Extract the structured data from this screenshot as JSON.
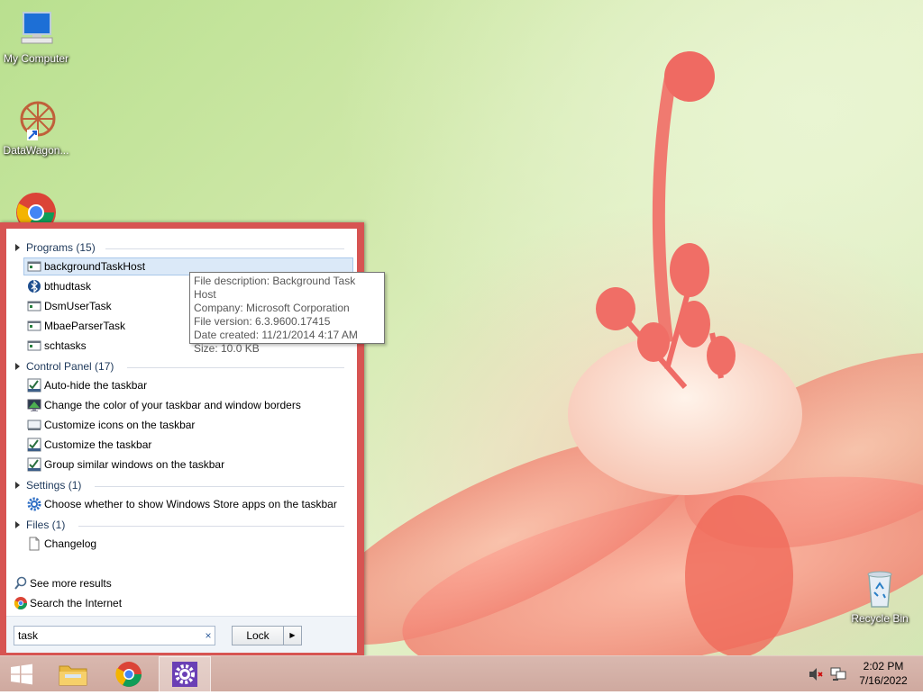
{
  "desktop": {
    "icons": [
      {
        "label": "My Computer",
        "icon": "computer-icon"
      },
      {
        "label": "DataWagon...",
        "icon": "datawagon-icon"
      },
      {
        "label": "",
        "icon": "chrome-icon"
      },
      {
        "label": "Recycle Bin",
        "icon": "recycle-bin-icon"
      }
    ]
  },
  "start_menu": {
    "groups": [
      {
        "header": "Programs (15)",
        "items": [
          {
            "label": "backgroundTaskHost",
            "icon": "app-window-icon",
            "selected": true
          },
          {
            "label": "bthudtask",
            "icon": "bluetooth-icon"
          },
          {
            "label": "DsmUserTask",
            "icon": "app-window-icon"
          },
          {
            "label": "MbaeParserTask",
            "icon": "app-window-icon"
          },
          {
            "label": "schtasks",
            "icon": "app-window-icon"
          }
        ]
      },
      {
        "header": "Control Panel (17)",
        "items": [
          {
            "label": "Auto-hide the taskbar",
            "icon": "taskbar-checklist-icon"
          },
          {
            "label": "Change the color of your taskbar and window borders",
            "icon": "color-monitor-icon"
          },
          {
            "label": "Customize icons on the taskbar",
            "icon": "notification-icons-icon"
          },
          {
            "label": "Customize the taskbar",
            "icon": "taskbar-checklist-icon"
          },
          {
            "label": "Group similar windows on the taskbar",
            "icon": "taskbar-checklist-icon"
          }
        ]
      },
      {
        "header": "Settings (1)",
        "items": [
          {
            "label": "Choose whether to show Windows Store apps on the taskbar",
            "icon": "settings-gear-icon"
          }
        ]
      },
      {
        "header": "Files (1)",
        "items": [
          {
            "label": "Changelog",
            "icon": "document-icon"
          }
        ]
      }
    ],
    "see_more": "See more results",
    "search_internet": "Search the Internet",
    "search": {
      "value": "task",
      "clear": "×"
    },
    "lock_label": "Lock",
    "lock_arrow": "▶"
  },
  "tooltip": {
    "lines": [
      "File description: Background Task Host",
      "Company: Microsoft Corporation",
      "File version: 6.3.9600.17415",
      "Date created: 11/21/2014 4:17 AM",
      "Size: 10.0 KB"
    ]
  },
  "taskbar": {
    "buttons": [
      "start-button",
      "file-explorer-button",
      "chrome-button",
      "settings-app-button"
    ],
    "clock": {
      "time": "2:02 PM",
      "date": "7/16/2022"
    }
  },
  "colors": {
    "start_border": "#d75452",
    "taskbar": "#d4b0a6",
    "accent": "#6a3fb5"
  }
}
